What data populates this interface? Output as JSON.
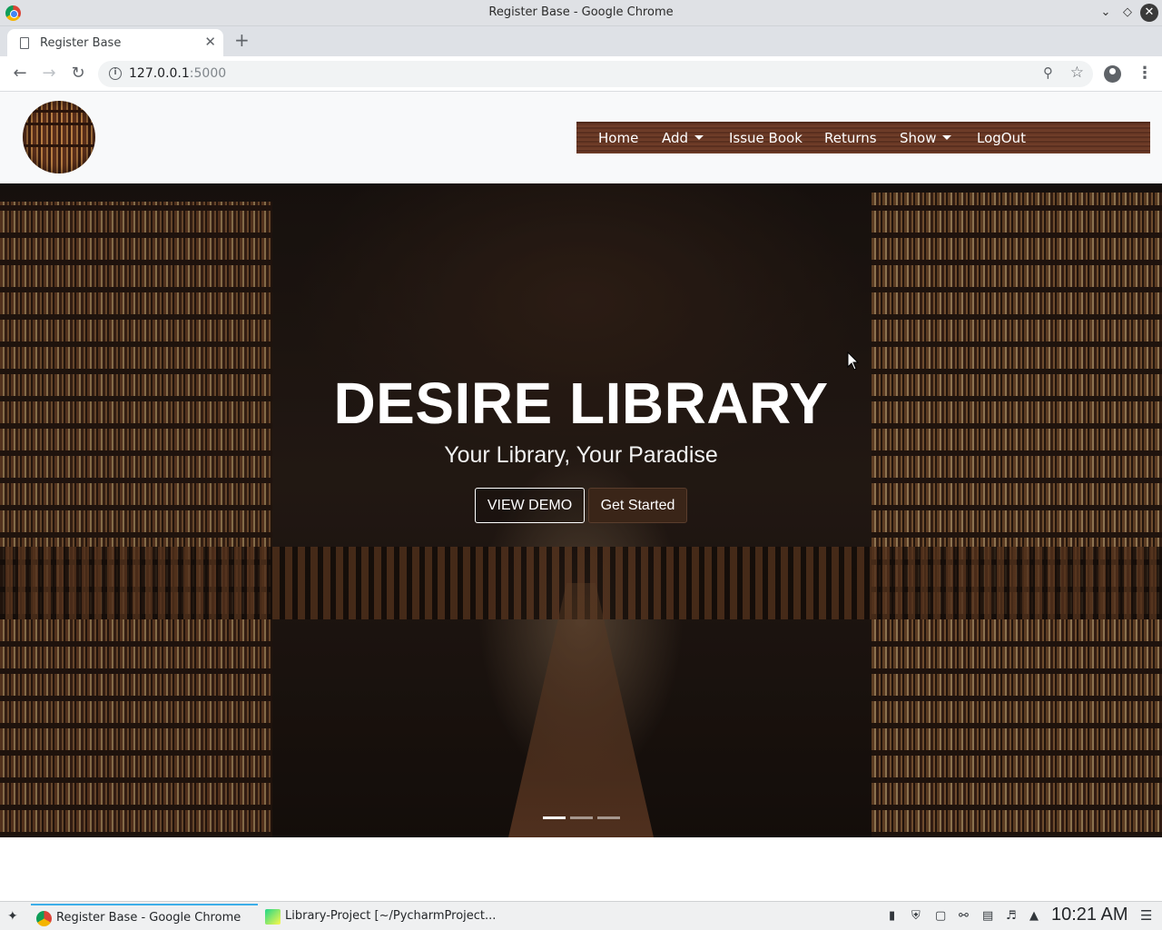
{
  "window": {
    "title": "Register Base - Google Chrome"
  },
  "browser": {
    "tab_title": "Register Base",
    "new_tab": "+",
    "url_host": "127.0.0.1",
    "url_port": ":5000"
  },
  "header": {
    "nav": [
      {
        "label": "Home"
      },
      {
        "label": "Add"
      },
      {
        "label": "Issue Book"
      },
      {
        "label": "Returns"
      },
      {
        "label": "Show"
      },
      {
        "label": "LogOut"
      }
    ]
  },
  "hero": {
    "title": "DESIRE LIBRARY",
    "subtitle": "Your Library, Your Paradise",
    "view_demo": "VIEW DEMO",
    "get_started": "Get Started"
  },
  "taskbar": {
    "tasks": [
      {
        "label": "Register Base - Google Chrome"
      },
      {
        "label": "Library-Project [~/PycharmProject..."
      }
    ],
    "clock": "10:21 AM"
  },
  "colors": {
    "navbar": "#6b3a26",
    "header_bg": "#f8f9fa",
    "get_started_bg": "#3a2518"
  }
}
